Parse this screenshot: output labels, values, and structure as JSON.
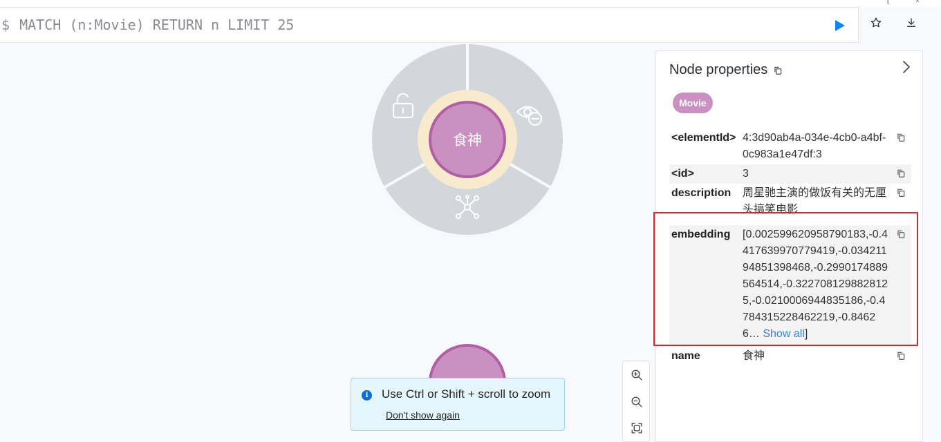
{
  "editor": {
    "prompt": "$",
    "query": "MATCH (n:Movie) RETURN n LIMIT 25"
  },
  "graph": {
    "center_node_label": "食神"
  },
  "toast": {
    "message": "Use Ctrl or Shift + scroll to zoom",
    "dismiss_label": "Don't show again"
  },
  "panel": {
    "title": "Node properties",
    "label_chip": "Movie",
    "properties": [
      {
        "key": "<elementId>",
        "value": "4:3d90ab4a-034e-4cb0-a4bf-0c983a1e47df:3"
      },
      {
        "key": "<id>",
        "value": "3"
      },
      {
        "key": "description",
        "value": "周星驰主演的做饭有关的无厘头搞笑电影"
      },
      {
        "key": "embedding",
        "value": "[0.002599620958790183,-0.4417639970779419,-0.03421194851398468,-0.2990174889564514,-0.3227081298828125,-0.0210006944835186,-0.4784315228462219,-0.84626…",
        "more": "Show all",
        "close": "]"
      },
      {
        "key": "name",
        "value": "食神"
      }
    ]
  },
  "colors": {
    "node_fill": "#c990c0",
    "node_border": "#b05fa6",
    "ring_fill": "#d3d6db",
    "selection_halo": "#f8ebcd",
    "run_button": "#0a84ff",
    "highlight_box": "#d9262b"
  },
  "icons": {
    "run": "play-icon",
    "favorite": "star-icon",
    "download": "download-icon",
    "unlock": "unlock-icon",
    "hide": "eye-minus-icon",
    "expand": "graph-expand-icon",
    "zoom_in": "zoom-in-icon",
    "zoom_out": "zoom-out-icon",
    "fit": "fit-screen-icon",
    "copy": "copy-icon",
    "collapse": "chevron-right-icon",
    "info": "info-icon"
  }
}
